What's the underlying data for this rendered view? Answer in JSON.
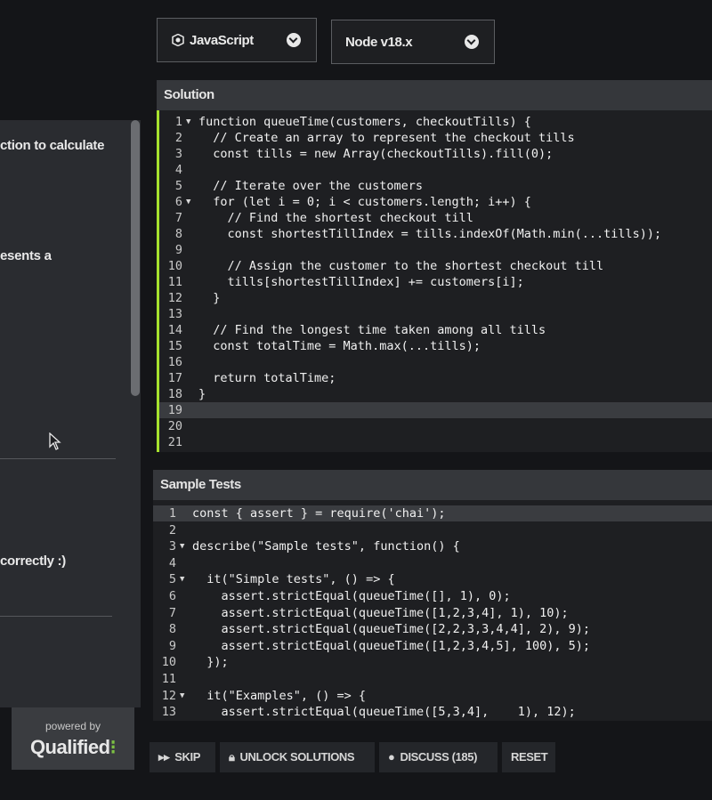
{
  "left": {
    "text1": "ction to calculate",
    "text2": "esents a",
    "text3": "correctly :)",
    "powered_by": "powered by",
    "brand": "Qualified",
    "brand_mark": "⁝"
  },
  "selectors": {
    "language": "JavaScript",
    "runtime": "Node v18.x"
  },
  "solution": {
    "title": "Solution",
    "lines": [
      "function queueTime(customers, checkoutTills) {",
      "  // Create an array to represent the checkout tills",
      "  const tills = new Array(checkoutTills).fill(0);",
      "",
      "  // Iterate over the customers",
      "  for (let i = 0; i < customers.length; i++) {",
      "    // Find the shortest checkout till",
      "    const shortestTillIndex = tills.indexOf(Math.min(...tills));",
      "",
      "    // Assign the customer to the shortest checkout till",
      "    tills[shortestTillIndex] += customers[i];",
      "  }",
      "",
      "  // Find the longest time taken among all tills",
      "  const totalTime = Math.max(...tills);",
      "",
      "  return totalTime;",
      "}",
      "",
      "",
      ""
    ],
    "fold_lines": [
      1,
      6
    ],
    "active_line": 19
  },
  "tests": {
    "title": "Sample Tests",
    "lines": [
      "const { assert } = require('chai');",
      "",
      "describe(\"Sample tests\", function() {",
      "",
      "  it(\"Simple tests\", () => {",
      "    assert.strictEqual(queueTime([], 1), 0);",
      "    assert.strictEqual(queueTime([1,2,3,4], 1), 10);",
      "    assert.strictEqual(queueTime([2,2,3,3,4,4], 2), 9);",
      "    assert.strictEqual(queueTime([1,2,3,4,5], 100), 5);",
      "  });",
      "",
      "  it(\"Examples\", () => {",
      "    assert.strictEqual(queueTime([5,3,4],    1), 12);"
    ],
    "fold_lines": [
      3,
      5,
      12
    ],
    "active_line": 1
  },
  "buttons": {
    "skip": "Skip",
    "unlock": "Unlock Solutions",
    "discuss": "Discuss (185)",
    "reset": "Reset"
  },
  "colors": {
    "accent_green": "#a6e22e",
    "brand_green": "#7cc142"
  }
}
